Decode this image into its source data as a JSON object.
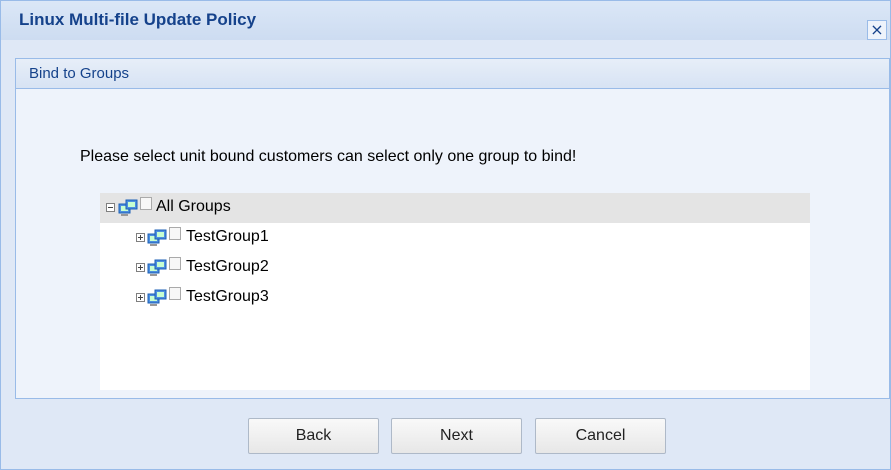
{
  "window": {
    "title": "Linux Multi-file Update Policy",
    "close_icon": "×"
  },
  "panel": {
    "title": "Bind to Groups",
    "instruction": "Please select unit bound customers can select only one group to bind!"
  },
  "tree": {
    "root": {
      "label": "All Groups",
      "icon": "group-icon"
    },
    "children": [
      {
        "label": "TestGroup1",
        "icon": "group-icon"
      },
      {
        "label": "TestGroup2",
        "icon": "group-icon"
      },
      {
        "label": "TestGroup3",
        "icon": "group-icon"
      }
    ]
  },
  "buttons": {
    "back": "Back",
    "next": "Next",
    "cancel": "Cancel"
  },
  "colors": {
    "title_text": "#15428b",
    "border": "#99bbe8",
    "background": "#dfe8f6"
  }
}
